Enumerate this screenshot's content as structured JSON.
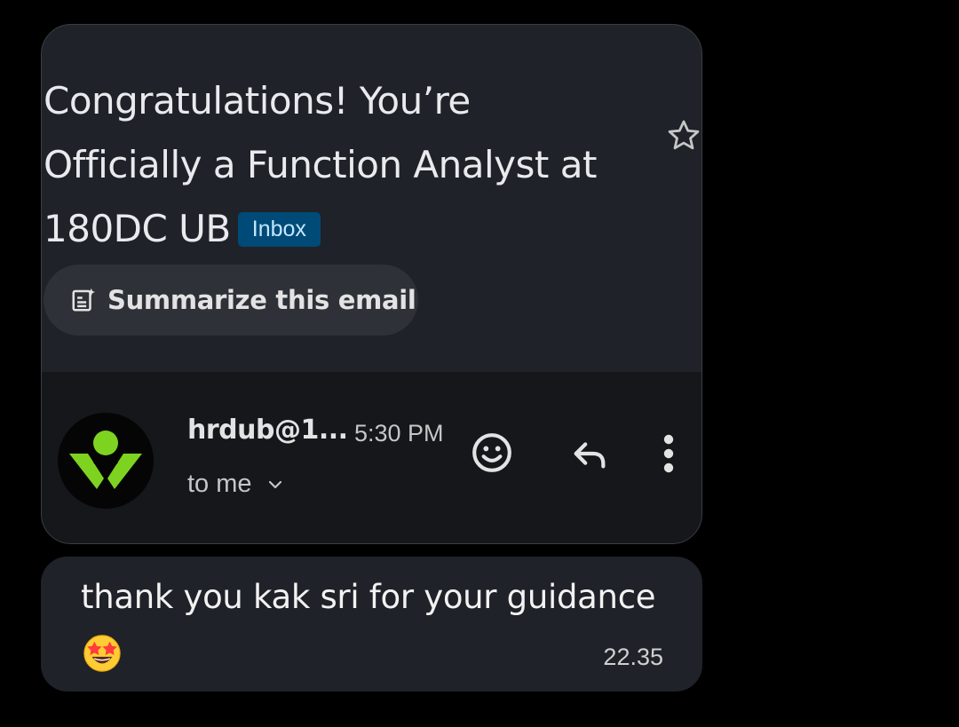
{
  "email": {
    "subject": "Congratulations! You’re Officially a Function Analyst at 180DC UB",
    "label_badge": "Inbox",
    "summarize_label": "Summarize this email",
    "sender": "hrdub@1...",
    "time": "5:30 PM",
    "recipient": "to me",
    "icons": {
      "star": "star-icon",
      "summarize": "summarize-icon",
      "emoji": "add-reaction-icon",
      "reply": "reply-icon",
      "more": "more-vertical-icon",
      "chevron": "chevron-down-icon"
    }
  },
  "message": {
    "text": "thank you kak sri for your guidance",
    "emoji": "star-struck-emoji",
    "time": "22.35"
  },
  "colors": {
    "background": "#000000",
    "card": "#1f2228",
    "sender_panel": "#15171b",
    "badge_bg": "#004a77",
    "badge_text": "#c2e7ff",
    "avatar_green": "#7ed321"
  }
}
